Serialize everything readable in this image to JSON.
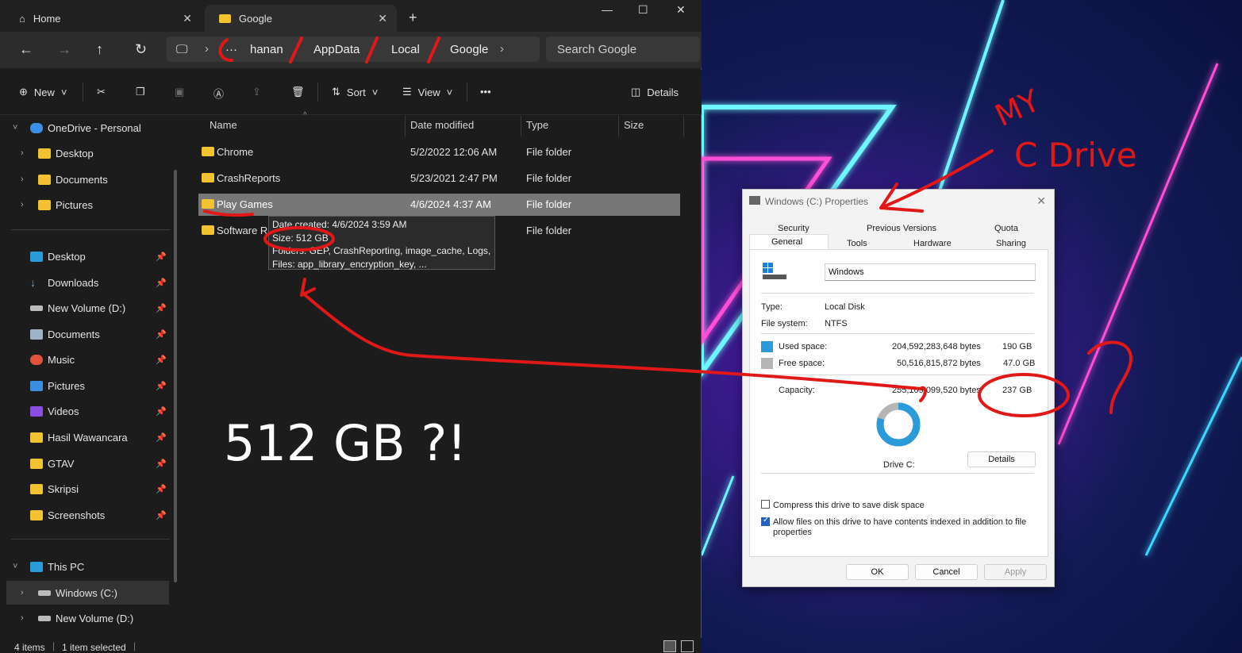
{
  "explorer": {
    "tabs": [
      {
        "label": "Home"
      },
      {
        "label": "Google"
      }
    ],
    "breadcrumb": [
      "hanan",
      "AppData",
      "Local",
      "Google"
    ],
    "search_placeholder": "Search Google",
    "toolbar": {
      "new": "New",
      "sort": "Sort",
      "view": "View",
      "details": "Details"
    },
    "sidebar": {
      "onedrive": "OneDrive - Personal",
      "onedrive_items": [
        "Desktop",
        "Documents",
        "Pictures"
      ],
      "quick": [
        "Desktop",
        "Downloads",
        "New Volume (D:)",
        "Documents",
        "Music",
        "Pictures",
        "Videos",
        "Hasil Wawancara",
        "GTAV",
        "Skripsi",
        "Screenshots"
      ],
      "thispc": "This PC",
      "pc_items": [
        "Windows (C:)",
        "New Volume (D:)"
      ]
    },
    "columns": {
      "name": "Name",
      "date": "Date modified",
      "type": "Type",
      "size": "Size"
    },
    "files": [
      {
        "name": "Chrome",
        "date": "5/2/2022 12:06 AM",
        "type": "File folder"
      },
      {
        "name": "CrashReports",
        "date": "5/23/2021 2:47 PM",
        "type": "File folder"
      },
      {
        "name": "Play Games",
        "date": "4/6/2024 4:37 AM",
        "type": "File folder"
      },
      {
        "name": "Software Re",
        "date": "",
        "type": "File folder"
      }
    ],
    "tooltip": {
      "created": "Date created: 4/6/2024 3:59 AM",
      "size": "Size: 512 GB",
      "folders": "Folders: GEP, CrashReporting, image_cache, Logs, ...",
      "files": "Files: app_library_encryption_key, ..."
    },
    "status": {
      "items": "4 items",
      "selected": "1 item selected"
    }
  },
  "props": {
    "title": "Windows (C:) Properties",
    "tabs_top": [
      "Security",
      "Previous Versions",
      "Quota"
    ],
    "tabs_bottom": [
      "General",
      "Tools",
      "Hardware",
      "Sharing"
    ],
    "drive_name": "Windows",
    "type_label": "Type:",
    "type_value": "Local Disk",
    "fs_label": "File system:",
    "fs_value": "NTFS",
    "used_label": "Used space:",
    "used_bytes": "204,592,283,648 bytes",
    "used_gb": "190 GB",
    "free_label": "Free space:",
    "free_bytes": "50,516,815,872 bytes",
    "free_gb": "47.0 GB",
    "cap_label": "Capacity:",
    "cap_bytes": "255,109,099,520 bytes",
    "cap_gb": "237 GB",
    "used_fraction": 0.8,
    "drive_label": "Drive C:",
    "details_btn": "Details",
    "compress": "Compress this drive to save disk space",
    "index_line1": "Allow files on this drive to have contents indexed in addition to file",
    "index_line2": "properties",
    "ok": "OK",
    "cancel": "Cancel",
    "apply": "Apply",
    "colors": {
      "used": "#2a9ad8",
      "free": "#b5b5b5"
    }
  },
  "annotations": {
    "my": "MY",
    "c_drive": "C Drive",
    "big": "512 GB ?!",
    "q": "?"
  }
}
